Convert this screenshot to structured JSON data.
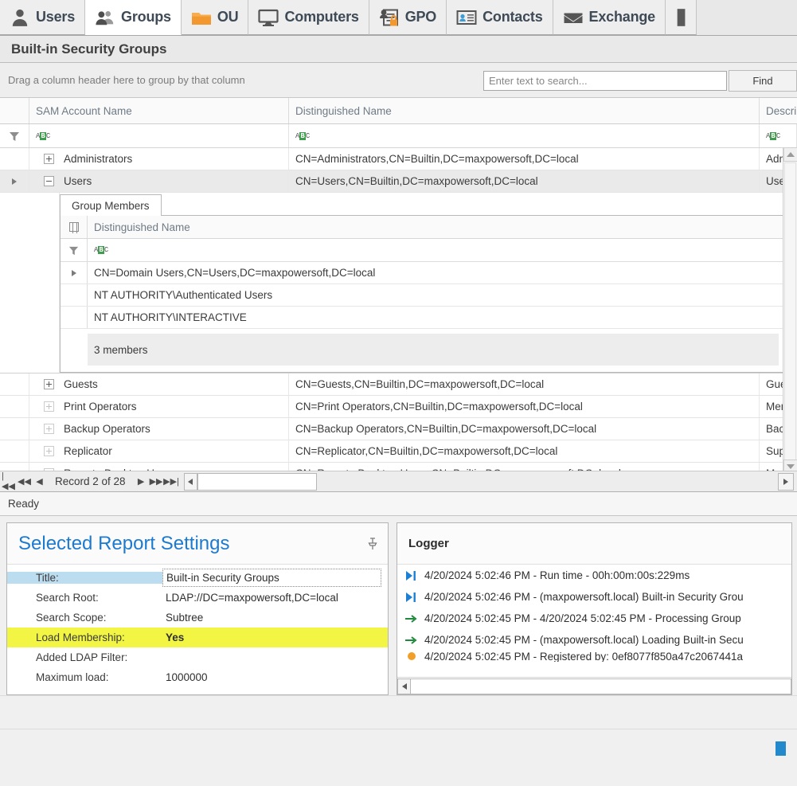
{
  "tabs": [
    {
      "label": "Users",
      "icon": "user-icon",
      "active": false
    },
    {
      "label": "Groups",
      "icon": "users-icon",
      "active": true
    },
    {
      "label": "OU",
      "icon": "folder-icon",
      "active": false
    },
    {
      "label": "Computers",
      "icon": "monitor-icon",
      "active": false
    },
    {
      "label": "GPO",
      "icon": "gpo-lock-icon",
      "active": false
    },
    {
      "label": "Contacts",
      "icon": "contact-card-icon",
      "active": false
    },
    {
      "label": "Exchange",
      "icon": "envelope-icon",
      "active": false
    }
  ],
  "report": {
    "title": "Built-in Security Groups"
  },
  "groupbar": {
    "hint": "Drag a column header here to group by that column",
    "search_placeholder": "Enter text to search...",
    "search_value": "",
    "find_label": "Find"
  },
  "grid": {
    "columns": [
      "SAM Account Name",
      "Distinguished Name",
      "Description"
    ],
    "filter_icon": "abc-filter-icon",
    "rows": [
      {
        "sam": "Administrators",
        "dn": "CN=Administrators,CN=Builtin,DC=maxpowersoft,DC=local",
        "desc": "Adm",
        "expanded": false,
        "selected": false
      },
      {
        "sam": "Users",
        "dn": "CN=Users,CN=Builtin,DC=maxpowersoft,DC=local",
        "desc": "Use",
        "expanded": true,
        "selected": true
      },
      {
        "sam": "Guests",
        "dn": "CN=Guests,CN=Builtin,DC=maxpowersoft,DC=local",
        "desc": "Gue",
        "expanded": false,
        "selected": false
      },
      {
        "sam": "Print Operators",
        "dn": "CN=Print Operators,CN=Builtin,DC=maxpowersoft,DC=local",
        "desc": "Men",
        "expanded": false,
        "selected": false
      },
      {
        "sam": "Backup Operators",
        "dn": "CN=Backup Operators,CN=Builtin,DC=maxpowersoft,DC=local",
        "desc": "Bac",
        "expanded": false,
        "selected": false
      },
      {
        "sam": "Replicator",
        "dn": "CN=Replicator,CN=Builtin,DC=maxpowersoft,DC=local",
        "desc": "Sup",
        "expanded": false,
        "selected": false
      },
      {
        "sam": "Remote Desktop Users",
        "dn": "CN=Remote Desktop Users,CN=Builtin,DC=maxpowersoft,DC=local",
        "desc": "Men",
        "expanded": false,
        "selected": false
      }
    ]
  },
  "detail": {
    "tab_label": "Group Members",
    "column": "Distinguished Name",
    "members": [
      "CN=Domain Users,CN=Users,DC=maxpowersoft,DC=local",
      "NT AUTHORITY\\Authenticated Users",
      "NT AUTHORITY\\INTERACTIVE"
    ],
    "summary": "3 members"
  },
  "recordnav": {
    "text": "Record 2 of 28",
    "first": "first-record-button",
    "prev_page": "previous-page-button",
    "prev": "previous-record-button",
    "next": "next-record-button",
    "next_page": "next-page-button",
    "last": "last-record-button"
  },
  "status": {
    "text": "Ready"
  },
  "settings_panel": {
    "title": "Selected Report Settings",
    "pin_icon": "pin-icon",
    "rows": [
      {
        "label": "Title:",
        "value": "Built-in Security Groups",
        "style": "title"
      },
      {
        "label": "Search Root:",
        "value": "LDAP://DC=maxpowersoft,DC=local",
        "style": "normal"
      },
      {
        "label": "Search Scope:",
        "value": "Subtree",
        "style": "normal"
      },
      {
        "label": "Load Membership:",
        "value": "Yes",
        "style": "highlight"
      },
      {
        "label": "Added LDAP Filter:",
        "value": "",
        "style": "normal"
      },
      {
        "label": "Maximum load:",
        "value": "1000000",
        "style": "normal"
      }
    ]
  },
  "logger_panel": {
    "title": "Logger",
    "entries": [
      {
        "icon": "play-end-icon",
        "icon_color": "#1d7fd4",
        "text": "4/20/2024 5:02:46 PM -  Run time - 00h:00m:00s:229ms"
      },
      {
        "icon": "play-end-icon",
        "icon_color": "#1d7fd4",
        "text": "4/20/2024 5:02:46 PM -  (maxpowersoft.local) Built-in Security Grou"
      },
      {
        "icon": "arrow-right-icon",
        "icon_color": "#1f8a3c",
        "text": "4/20/2024 5:02:45 PM -  4/20/2024 5:02:45 PM -  Processing Group"
      },
      {
        "icon": "arrow-right-icon",
        "icon_color": "#1f8a3c",
        "text": "4/20/2024 5:02:45 PM -  (maxpowersoft.local) Loading Built-in Secu"
      },
      {
        "icon": "info-dot-icon",
        "icon_color": "#f0a02a",
        "text": "4/20/2024 5:02:45 PM -  Registered by: 0ef8077f850a47c2067441a"
      }
    ]
  },
  "footer": {
    "indicator_icon": "blue-square-icon",
    "indicator_color": "#2389cd"
  }
}
